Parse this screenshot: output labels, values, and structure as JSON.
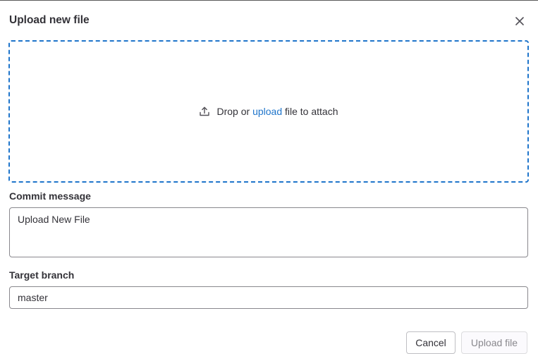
{
  "modal": {
    "title": "Upload new file",
    "close_icon": "close-icon"
  },
  "dropzone": {
    "icon": "upload-icon",
    "text_before": "Drop or ",
    "link_text": "upload",
    "text_after": " file to attach",
    "border_color": "#1f75cb"
  },
  "commit": {
    "label": "Commit message",
    "value": "Upload New File"
  },
  "branch": {
    "label": "Target branch",
    "value": "master"
  },
  "actions": {
    "cancel_label": "Cancel",
    "upload_label": "Upload file",
    "upload_disabled": true
  },
  "colors": {
    "link": "#1f75cb",
    "text": "#333238",
    "disabled_text": "#89888d"
  }
}
